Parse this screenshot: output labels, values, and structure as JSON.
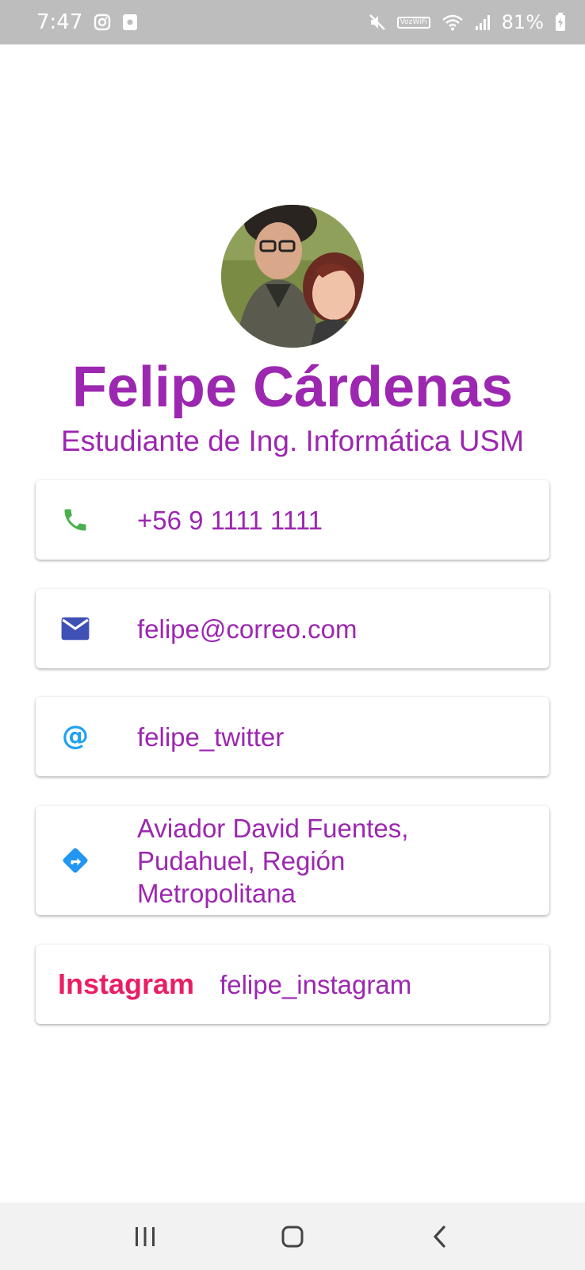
{
  "status_bar": {
    "time": "7:47",
    "battery": "81%",
    "wifi_badge_top": "Voz",
    "wifi_badge_bottom": "WiFi",
    "left_icons": [
      "instagram-icon",
      "notification-icon"
    ],
    "right_icons": [
      "mute-icon",
      "voz-wifi-icon",
      "wifi-icon",
      "signal-icon",
      "battery-charging-icon"
    ]
  },
  "profile": {
    "name": "Felipe Cárdenas",
    "subtitle": "Estudiante de Ing. Informática USM"
  },
  "contacts": {
    "phone": {
      "icon": "phone-icon",
      "value": "+56 9 1111 1111",
      "color": "#4caf50"
    },
    "email": {
      "icon": "email-icon",
      "value": "felipe@correo.com",
      "color": "#3f51b5"
    },
    "twitter": {
      "icon": "at-icon",
      "value": "felipe_twitter",
      "color": "#1da1f2"
    },
    "address": {
      "icon": "directions-icon",
      "line1": "Aviador David Fuentes,",
      "line2": "Pudahuel, Región",
      "line3": "Metropolitana",
      "color": "#2196f3"
    },
    "instagram": {
      "label": "Instagram",
      "value": "felipe_instagram",
      "color": "#e91e63"
    }
  },
  "nav": {
    "buttons": [
      "recents-icon",
      "home-icon",
      "back-icon"
    ]
  },
  "colors": {
    "accent": "#9c27b0",
    "status_bar": "#bdbdbd",
    "nav_bar": "#f2f2f2"
  }
}
